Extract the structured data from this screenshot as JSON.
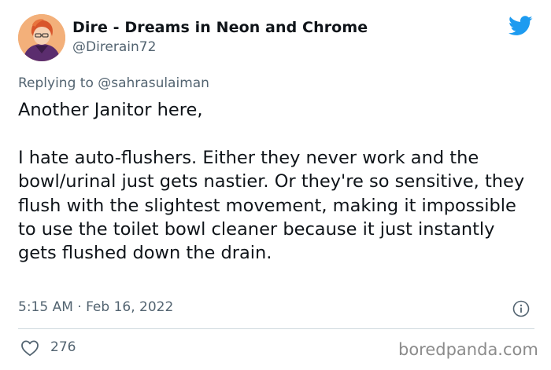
{
  "author": {
    "display_name": "Dire - Dreams in Neon and Chrome",
    "handle": "@Direrain72"
  },
  "reply": {
    "prefix": "Replying to",
    "mention": "@sahrasulaiman"
  },
  "tweet": {
    "text": "Another Janitor here,\n\nI hate auto-flushers. Either they never work and the bowl/urinal just gets nastier. Or they're so sensitive, they flush with the slightest movement, making it impossible to use the toilet bowl cleaner because it just instantly gets flushed down the drain.",
    "timestamp": "5:15 AM · Feb 16, 2022",
    "like_count": "276"
  },
  "watermark": "boredpanda.com",
  "colors": {
    "twitter_blue": "#1d9bf0",
    "secondary_text": "#536471",
    "primary_text": "#0f1419"
  },
  "icons": {
    "brand": "twitter-bird-icon",
    "info": "info-icon",
    "like": "heart-icon"
  }
}
